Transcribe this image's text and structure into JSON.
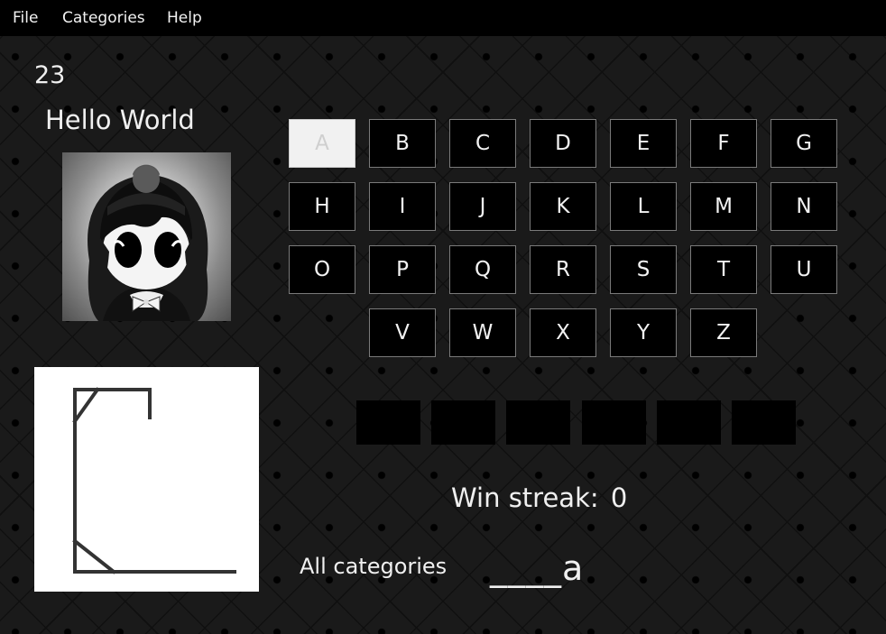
{
  "menu": {
    "file": "File",
    "categories": "Categories",
    "help": "Help"
  },
  "score": "23",
  "player": {
    "name": "Hello World"
  },
  "keyboard": {
    "row1": [
      "A",
      "B",
      "C",
      "D",
      "E",
      "F",
      "G"
    ],
    "row2": [
      "H",
      "I",
      "J",
      "K",
      "L",
      "M",
      "N"
    ],
    "row3": [
      "O",
      "P",
      "Q",
      "R",
      "S",
      "T",
      "U"
    ],
    "row4": [
      "V",
      "W",
      "X",
      "Y",
      "Z"
    ],
    "used": [
      "A"
    ]
  },
  "streak": {
    "label": "Win streak:",
    "value": "0"
  },
  "category": "All categories",
  "word": "____a",
  "colors": {
    "menubar": "#000000",
    "background": "#1a1a1a",
    "key": "#000000",
    "key_used": "#f1f1f1",
    "key_border": "#7a7a7a"
  }
}
